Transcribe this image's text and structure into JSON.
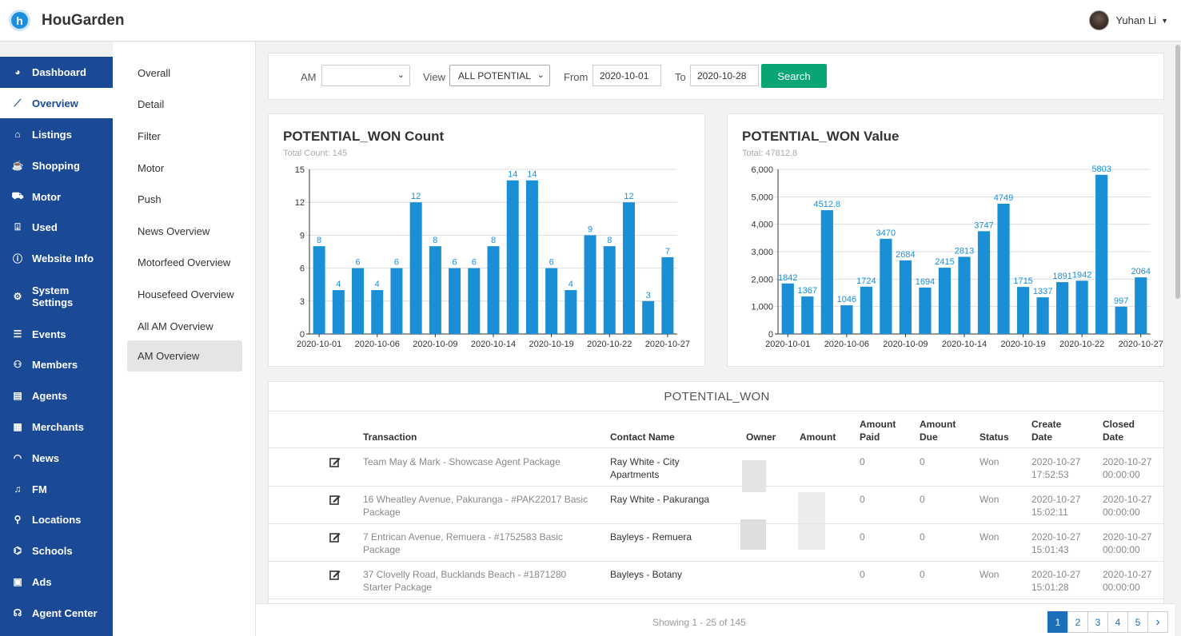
{
  "app": {
    "brand": "HouGarden",
    "logo_letter": "h",
    "user_name": "Yuhan Li"
  },
  "sidebar": {
    "items": [
      {
        "label": "Dashboard",
        "icon": "dashboard-icon"
      },
      {
        "label": "Overview",
        "icon": "chart-line-icon",
        "active": true
      },
      {
        "label": "Listings",
        "icon": "home-icon"
      },
      {
        "label": "Shopping",
        "icon": "coffee-cup-icon"
      },
      {
        "label": "Motor",
        "icon": "car-icon"
      },
      {
        "label": "Used",
        "icon": "dolly-icon"
      },
      {
        "label": "Website Info",
        "icon": "info-circle-icon"
      },
      {
        "label": "System Settings",
        "icon": "cogs-icon"
      },
      {
        "label": "Events",
        "icon": "list-icon"
      },
      {
        "label": "Members",
        "icon": "users-icon"
      },
      {
        "label": "Agents",
        "icon": "id-card-icon"
      },
      {
        "label": "Merchants",
        "icon": "store-icon"
      },
      {
        "label": "News",
        "icon": "rss-icon"
      },
      {
        "label": "FM",
        "icon": "music-icon"
      },
      {
        "label": "Locations",
        "icon": "map-marker-icon"
      },
      {
        "label": "Schools",
        "icon": "school-icon"
      },
      {
        "label": "Ads",
        "icon": "ad-icon"
      },
      {
        "label": "Agent Center",
        "icon": "headset-icon"
      }
    ]
  },
  "subnav": {
    "items": [
      "Overall",
      "Detail",
      "Filter",
      "Motor",
      "Push",
      "News Overview",
      "Motorfeed Overview",
      "Housefeed Overview",
      "All AM Overview",
      "AM Overview"
    ],
    "active": "AM Overview"
  },
  "filter": {
    "am_label": "AM",
    "am_value": "",
    "view_label": "View",
    "view_value": "ALL POTENTIAL",
    "from_label": "From",
    "from_value": "2020-10-01",
    "to_label": "To",
    "to_value": "2020-10-28",
    "search_label": "Search"
  },
  "chart_data": [
    {
      "type": "bar",
      "title": "POTENTIAL_WON Count",
      "subtitle": "Total Count: 145",
      "color": "#1a8fd6",
      "categories": [
        "2020-10-01",
        "2020-10-02",
        "2020-10-05",
        "2020-10-06",
        "2020-10-07",
        "2020-10-08",
        "2020-10-09",
        "2020-10-12",
        "2020-10-13",
        "2020-10-14",
        "2020-10-15",
        "2020-10-16",
        "2020-10-19",
        "2020-10-20",
        "2020-10-21",
        "2020-10-22",
        "2020-10-23",
        "2020-10-26",
        "2020-10-27"
      ],
      "tick_labels": [
        "2020-10-01",
        "2020-10-06",
        "2020-10-09",
        "2020-10-14",
        "2020-10-19",
        "2020-10-22",
        "2020-10-27"
      ],
      "values": [
        8,
        4,
        6,
        4,
        6,
        12,
        8,
        6,
        6,
        8,
        14,
        14,
        6,
        4,
        9,
        8,
        12,
        3,
        7
      ],
      "yticks": [
        "0",
        "3",
        "6",
        "9",
        "12",
        "15"
      ],
      "ylim": [
        0,
        15
      ]
    },
    {
      "type": "bar",
      "title": "POTENTIAL_WON Value",
      "subtitle": "Total: 47812.8",
      "color": "#1a8fd6",
      "categories": [
        "2020-10-01",
        "2020-10-02",
        "2020-10-05",
        "2020-10-06",
        "2020-10-07",
        "2020-10-08",
        "2020-10-09",
        "2020-10-12",
        "2020-10-13",
        "2020-10-14",
        "2020-10-15",
        "2020-10-16",
        "2020-10-19",
        "2020-10-20",
        "2020-10-21",
        "2020-10-22",
        "2020-10-23",
        "2020-10-26",
        "2020-10-27"
      ],
      "tick_labels": [
        "2020-10-01",
        "2020-10-06",
        "2020-10-09",
        "2020-10-14",
        "2020-10-19",
        "2020-10-22",
        "2020-10-27"
      ],
      "values": [
        1842,
        1367,
        4512.8,
        1046,
        1724,
        3470,
        2684,
        1694,
        2415,
        2813,
        3747,
        4749,
        1715,
        1337,
        1891,
        1942,
        5803,
        997,
        2064
      ],
      "yticks": [
        "0",
        "1,000",
        "2,000",
        "3,000",
        "4,000",
        "5,000",
        "6,000"
      ],
      "ylim": [
        0,
        6000
      ]
    }
  ],
  "table": {
    "title": "POTENTIAL_WON",
    "headers": {
      "transaction": "Transaction",
      "contact": "Contact Name",
      "owner": "Owner",
      "amount": "Amount",
      "amount_paid": [
        "Amount",
        "Paid"
      ],
      "amount_due": [
        "Amount",
        "Due"
      ],
      "status": "Status",
      "create_date": [
        "Create",
        "Date"
      ],
      "closed_date": [
        "Closed",
        "Date"
      ]
    },
    "rows": [
      {
        "transaction": [
          "Team May & Mark - Showcase Agent Package"
        ],
        "contact": [
          "Ray White - City",
          "Apartments"
        ],
        "paid": "0",
        "due": "0",
        "status": "Won",
        "create": [
          "2020-10-27",
          "17:52:53"
        ],
        "closed": [
          "2020-10-27",
          "00:00:00"
        ]
      },
      {
        "transaction": [
          "16 Wheatley Avenue, Pakuranga - #PAK22017 Basic",
          "Package"
        ],
        "contact": [
          "Ray White - Pakuranga"
        ],
        "paid": "0",
        "due": "0",
        "status": "Won",
        "create": [
          "2020-10-27",
          "15:02:11"
        ],
        "closed": [
          "2020-10-27",
          "00:00:00"
        ]
      },
      {
        "transaction": [
          "7 Entrican Avenue, Remuera - #1752583 Basic",
          "Package"
        ],
        "contact": [
          "Bayleys - Remuera"
        ],
        "paid": "0",
        "due": "0",
        "status": "Won",
        "create": [
          "2020-10-27",
          "15:01:43"
        ],
        "closed": [
          "2020-10-27",
          "00:00:00"
        ]
      },
      {
        "transaction": [
          "37 Clovelly Road, Bucklands Beach - #1871280",
          "Starter Package"
        ],
        "contact": [
          "Bayleys - Botany"
        ],
        "paid": "0",
        "due": "0",
        "status": "Won",
        "create": [
          "2020-10-27",
          "15:01:28"
        ],
        "closed": [
          "2020-10-27",
          "00:00:00"
        ]
      }
    ]
  },
  "footer": {
    "showing": "Showing 1 - 25 of 145",
    "pages": [
      "1",
      "2",
      "3",
      "4",
      "5"
    ],
    "next": "›"
  }
}
